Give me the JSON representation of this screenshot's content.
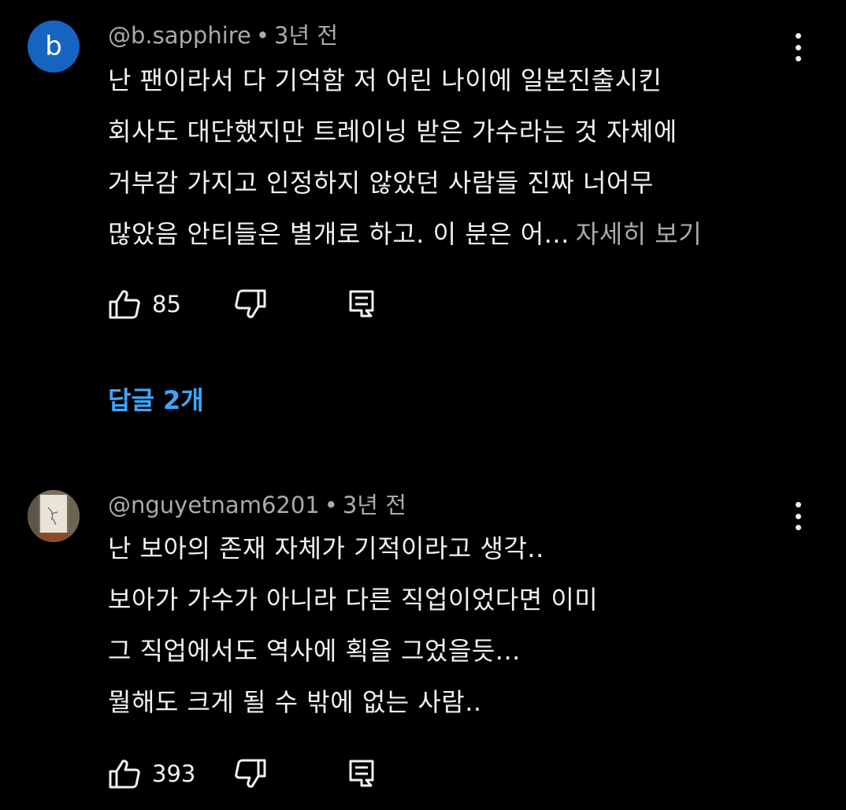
{
  "comments": [
    {
      "avatar_letter": "b",
      "avatar_color": "#1565c0",
      "author": "@b.sapphire",
      "separator": "•",
      "time": "3년 전",
      "lines": [
        "난 팬이라서 다 기억함 저 어린 나이에 일본진출시킨",
        "회사도 대단했지만 트레이닝 받은 가수라는 것 자체에",
        "거부감 가지고 인정하지 않았던 사람들 진짜 너어무",
        "많았음 안티들은 별개로 하고. 이 분은 어..."
      ],
      "read_more": "자세히 보기",
      "likes": "85",
      "replies": "답글 2개"
    },
    {
      "author": "@nguyetnam6201",
      "separator": "•",
      "time": "3년 전",
      "lines": [
        "난 보아의 존재 자체가 기적이라고 생각..",
        "보아가 가수가 아니라 다른 직업이었다면 이미",
        "그 직업에서도 역사에 획을 그었을듯...",
        "뭘해도 크게 될 수 밖에 없는 사람.."
      ],
      "likes": "393"
    }
  ],
  "icons": {
    "like": "thumb-up-icon",
    "dislike": "thumb-down-icon",
    "reply": "comment-icon",
    "menu": "more-vert-icon"
  },
  "colors": {
    "background": "#000000",
    "text": "#f1f1f1",
    "secondary": "#aaaaaa",
    "link": "#3ea6ff"
  }
}
